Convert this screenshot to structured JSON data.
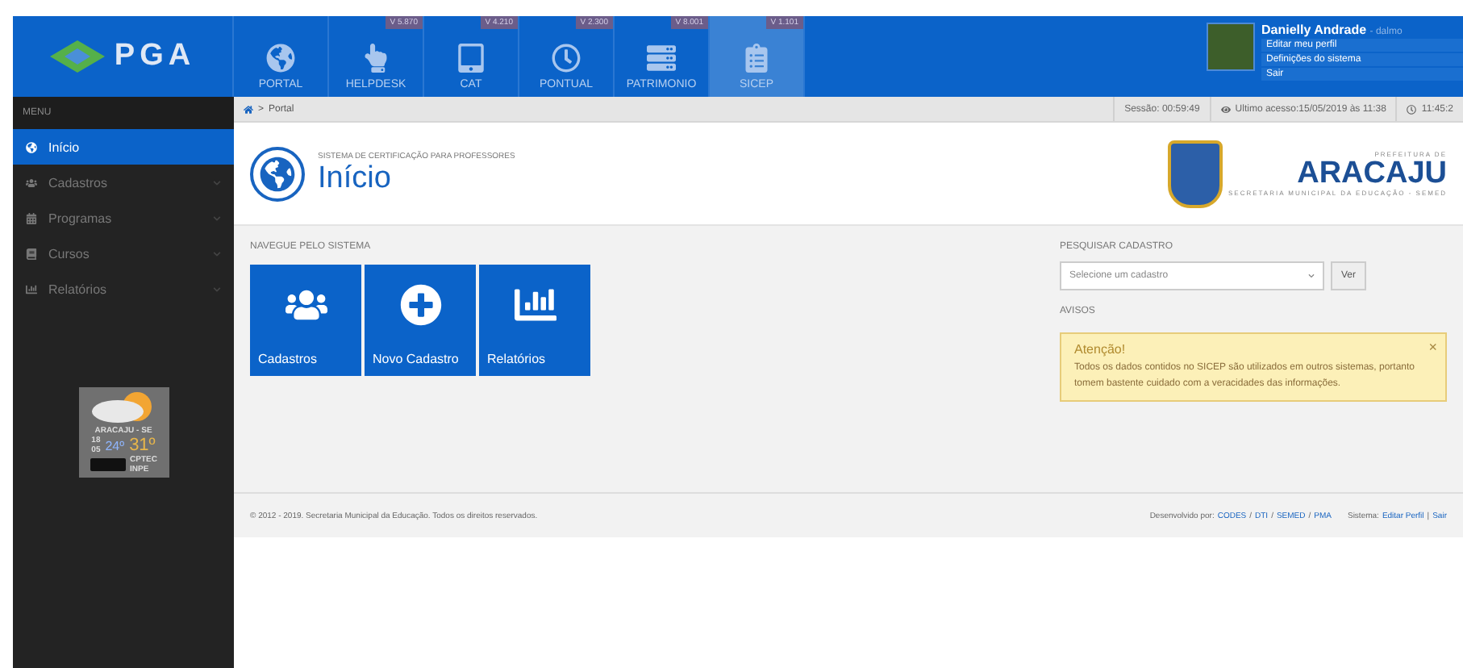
{
  "header": {
    "logo": "PGA",
    "apps": [
      {
        "label": "PORTAL",
        "selected": false
      },
      {
        "label": "HELPDESK",
        "version": "V 5.870",
        "selected": false
      },
      {
        "label": "CAT",
        "version": "V 4.210",
        "selected": false
      },
      {
        "label": "PONTUAL",
        "version": "V 2.300",
        "selected": false
      },
      {
        "label": "PATRIMONIO",
        "version": "V 8.001",
        "selected": false
      },
      {
        "label": "SICEP",
        "version": "V 1.101",
        "selected": true
      }
    ],
    "user": {
      "name": "Danielly Andrade",
      "login": "- dalmo",
      "links": [
        "Editar meu perfil",
        "Definições do sistema",
        "Sair"
      ]
    }
  },
  "sidebar": {
    "title": "MENU",
    "items": [
      {
        "label": "Início",
        "selected": true,
        "expandable": false
      },
      {
        "label": "Cadastros",
        "selected": false,
        "expandable": true
      },
      {
        "label": "Programas",
        "selected": false,
        "expandable": true
      },
      {
        "label": "Cursos",
        "selected": false,
        "expandable": true
      },
      {
        "label": "Relatórios",
        "selected": false,
        "expandable": true
      }
    ],
    "weather": {
      "city": "ARACAJU - SE",
      "day": "18",
      "month": "05",
      "min": "24º",
      "max": "31º",
      "source": "CPTEC",
      "source2": "INPE"
    }
  },
  "breadcrumb": {
    "separator": ">",
    "label": "Portal"
  },
  "status": {
    "session": "Sessão: 00:59:49",
    "last_access": "Ultimo acesso:15/05/2019 às 11:38",
    "time": "11:45:2"
  },
  "page": {
    "subtitle": "SISTEMA DE CERTIFICAÇÃO PARA PROFESSORES",
    "title": "Início",
    "brand": {
      "top": "PREFEITURA DE",
      "name": "ARACAJU",
      "bottom": "SECRETARIA MUNICIPAL DA EDUCAÇÃO - SEMED"
    }
  },
  "navigate": {
    "title": "NAVEGUE PELO SISTEMA",
    "tiles": [
      "Cadastros",
      "Novo Cadastro",
      "Relatórios"
    ]
  },
  "search": {
    "title": "PESQUISAR CADASTRO",
    "placeholder": "Selecione um cadastro",
    "button": "Ver"
  },
  "notices": {
    "title": "AVISOS",
    "alert": {
      "heading": "Atenção!",
      "text": "Todos os dados contidos no SICEP são utilizados em outros sistemas, portanto tomem bastente cuidado com a veracidades das informações.",
      "close": "×"
    }
  },
  "footer": {
    "copyright": "© 2012 - 2019. Secretaria Municipal da Educação. Todos os direitos reservados.",
    "dev_label": "Desenvolvido por:",
    "dev_links": [
      "CODES",
      "DTI",
      "SEMED",
      "PMA"
    ],
    "dev_separator": "/",
    "system_label": "Sistema:",
    "system_links": [
      "Editar Perfil",
      "Sair"
    ],
    "system_separator": "|"
  }
}
